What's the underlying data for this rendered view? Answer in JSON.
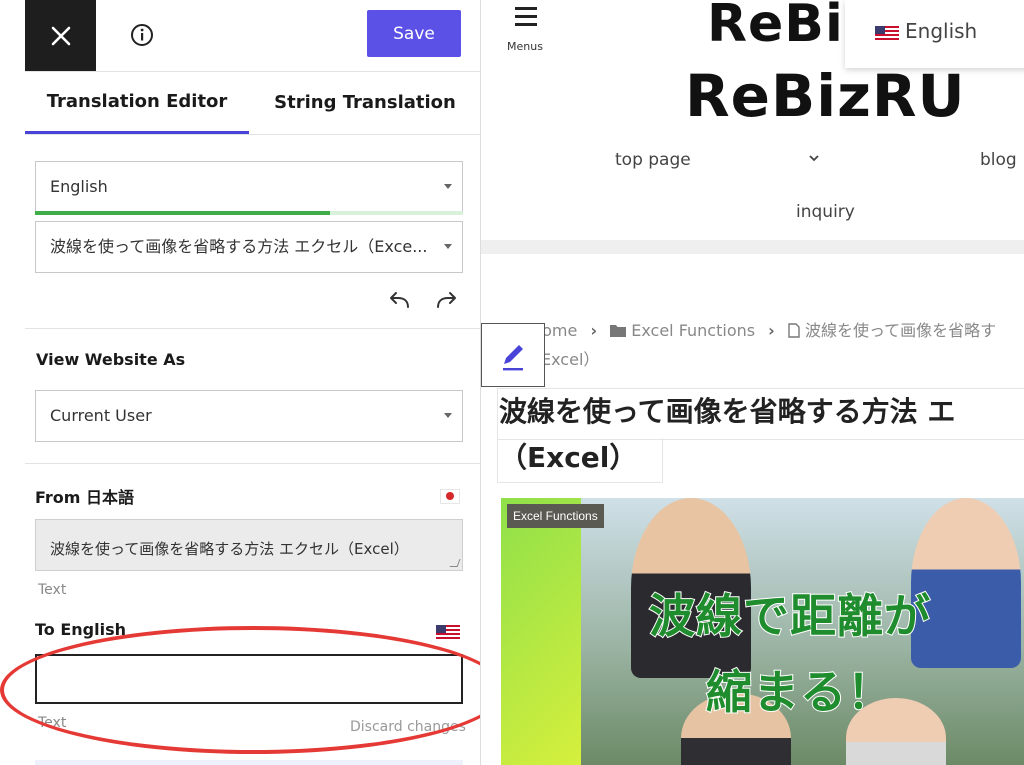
{
  "editor": {
    "save_label": "Save",
    "tabs": [
      {
        "label": "Translation Editor",
        "active": true
      },
      {
        "label": "String Translation",
        "active": false
      }
    ],
    "language_select": {
      "value": "English"
    },
    "translation_progress": 0.69,
    "page_select": {
      "value": "波線を使って画像を省略する方法 エクセル（Exce..."
    },
    "view_as": {
      "label": "View Website As",
      "value": "Current User"
    },
    "from": {
      "label": "From 日本語",
      "text": "波線を使って画像を省略する方法 エクセル（Excel）",
      "type": "Text"
    },
    "to": {
      "label": "To English",
      "value": "",
      "type": "Text",
      "discard_label": "Discard changes"
    },
    "colors": {
      "accent": "#5b51e6",
      "progress": "#3fae49",
      "highlight": "#e53935"
    }
  },
  "preview": {
    "menu_label": "Menus",
    "logo_top": "ReBiz",
    "logo_main": "ReBizRU",
    "language_switcher": "English",
    "nav": {
      "top_page": "top page",
      "blog": "blog",
      "inquiry": "inquiry"
    },
    "breadcrumb": {
      "home": "Home",
      "category": "Excel Functions",
      "current": "波線を使って画像を省略す",
      "current_cont": "Excel）"
    },
    "post_title_line1": "波線を使って画像を省略する方法 エ",
    "post_title_line2": "（Excel）",
    "hero": {
      "category_badge": "Excel Functions",
      "text_line1": "波線で距離が",
      "text_line2": "縮まる！"
    }
  }
}
